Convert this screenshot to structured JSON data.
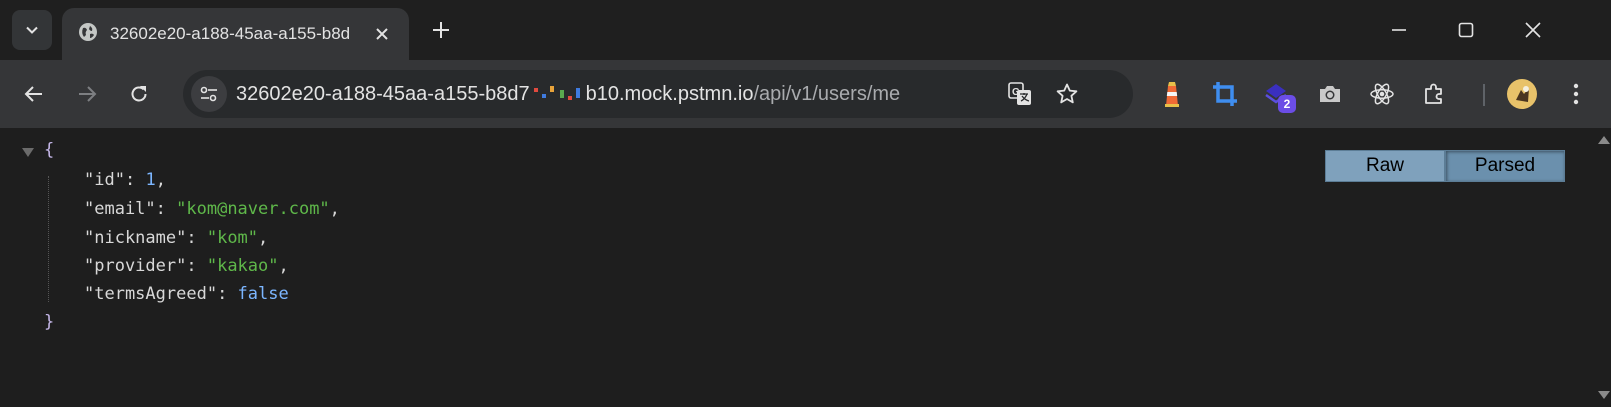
{
  "tab": {
    "title": "32602e20-a188-45aa-a155-b8d",
    "favicon": "globe-icon",
    "close": "close-icon"
  },
  "window": {
    "minimize": "minimize-icon",
    "maximize": "maximize-icon",
    "close": "close-icon"
  },
  "toolbar": {
    "back": "arrow-left-icon",
    "forward": "arrow-right-icon",
    "reload": "reload-icon"
  },
  "omnibox": {
    "url_prefix": "32602e20-a188-45aa-a155-b8d7",
    "url_host_rest": "b10.mock.pstmn.io",
    "url_path": "/api/v1/users/me",
    "site_info_icon": "tune-icon",
    "translate_icon": "translate-icon",
    "bookmark_icon": "star-icon"
  },
  "extensions": {
    "items": [
      "lighthouse-icon",
      "crop-icon",
      "layers-icon",
      "camera-icon",
      "react-icon",
      "puzzle-icon"
    ],
    "badge_count": "2",
    "profile": "avatar",
    "menu": "more-vert-icon"
  },
  "viewer": {
    "raw_label": "Raw",
    "parsed_label": "Parsed",
    "selected": "Parsed"
  },
  "json": {
    "open_brace": "{",
    "close_brace": "}",
    "fields": [
      {
        "key": "\"id\"",
        "value": "1",
        "type": "number",
        "comma": ","
      },
      {
        "key": "\"email\"",
        "value": "\"kom@naver.com\"",
        "type": "string",
        "comma": ","
      },
      {
        "key": "\"nickname\"",
        "value": "\"kom\"",
        "type": "string",
        "comma": ","
      },
      {
        "key": "\"provider\"",
        "value": "\"kakao\"",
        "type": "string",
        "comma": ","
      },
      {
        "key": "\"termsAgreed\"",
        "value": "false",
        "type": "boolean",
        "comma": ""
      }
    ]
  },
  "colors": {
    "tab_bg": "#353638",
    "omnibox_bg": "#282a2c",
    "json_key": "#d8d8d8",
    "json_string": "#5fb84a",
    "json_number": "#7cb6ff",
    "json_bool": "#7cb6ff",
    "json_brace": "#c5b7e8",
    "badge": "#6b4de6"
  }
}
